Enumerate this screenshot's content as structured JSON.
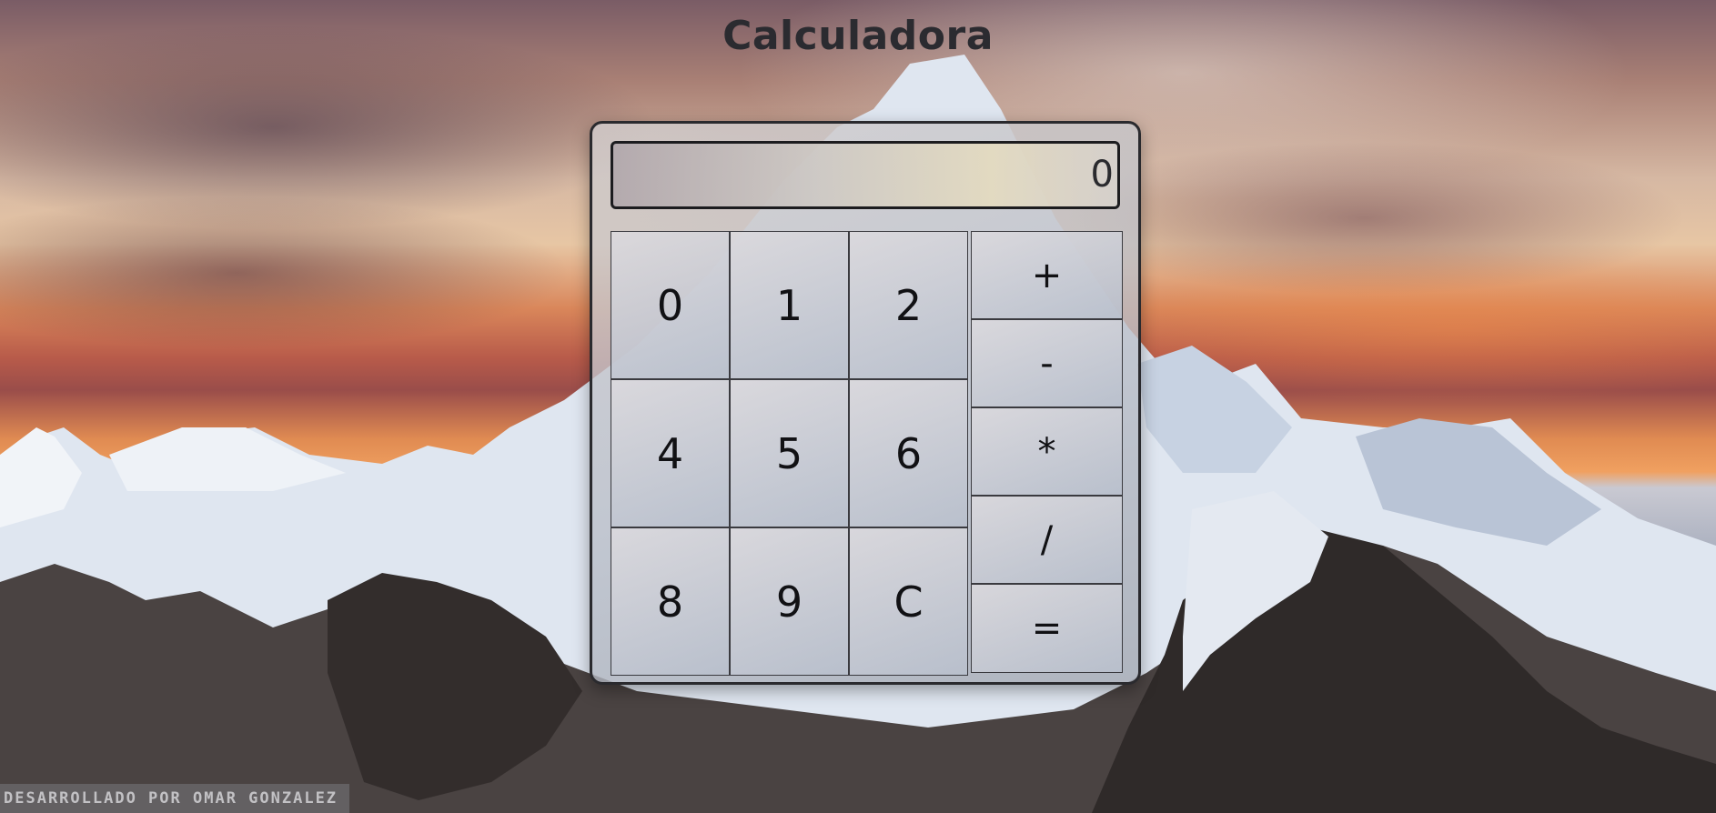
{
  "page": {
    "title": "Calculadora",
    "watermark": "DESARROLLADO POR OMAR GONZALEZ"
  },
  "calculator": {
    "display_value": "0",
    "digit_keys": [
      "0",
      "1",
      "2",
      "4",
      "5",
      "6",
      "8",
      "9",
      "C"
    ],
    "operator_keys": [
      "+",
      "-",
      "*",
      "/",
      "="
    ]
  },
  "colors": {
    "title_text": "#2b2b30",
    "panel_border": "#2a2a2e",
    "key_text": "#111114"
  }
}
